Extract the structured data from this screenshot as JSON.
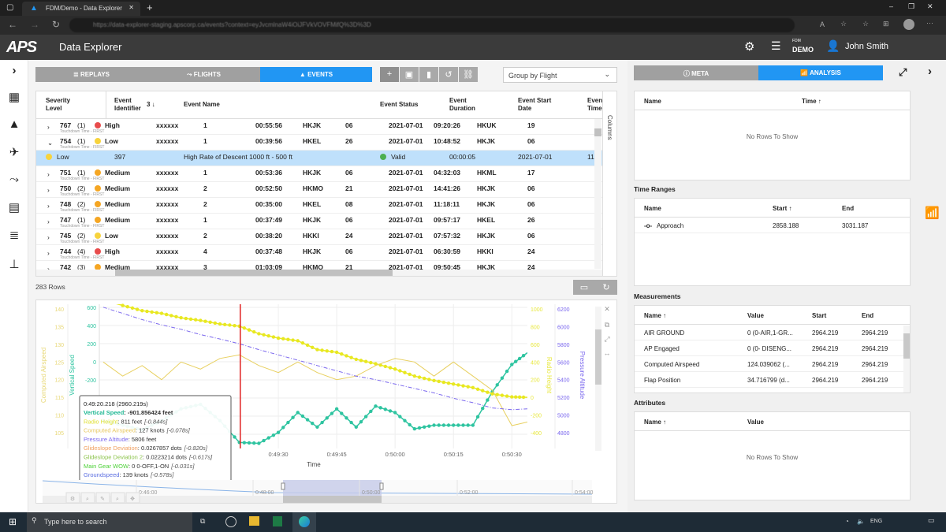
{
  "browser": {
    "tab_title": "FDM/Demo - Data Explorer",
    "url": "https://data-explorer-staging.apscorp.ca/events?context=eyJvcmlnaW4iOiJFVkVOVFMifQ%3D%3D"
  },
  "app": {
    "logo": "APS",
    "title": "Data Explorer",
    "org_small": "FDM",
    "org": "DEMO",
    "user": "John Smith"
  },
  "main_tabs": [
    {
      "label": "REPLAYS",
      "icon": "database-icon"
    },
    {
      "label": "FLIGHTS",
      "icon": "route-icon"
    },
    {
      "label": "EVENTS",
      "icon": "warning-icon",
      "active": true
    }
  ],
  "group_select": {
    "value": "Group by Flight"
  },
  "table": {
    "columns": [
      "Severity Level",
      "Event Identifier",
      "3 ↓",
      "Event Name",
      "Event Status",
      "Event Duration",
      "Event Start Date",
      "Event Time"
    ],
    "sub_label": "Touchdown Time - FIRST",
    "rows": [
      [
        "767",
        "(1)",
        "High",
        "xxxxxx",
        "1",
        "00:55:56",
        "HKJK",
        "06",
        "2021-07-01",
        "09:20:26",
        "HKUK",
        "19"
      ],
      [
        "754",
        "(1)",
        "Low",
        "xxxxxx",
        "1",
        "00:39:56",
        "HKEL",
        "26",
        "2021-07-01",
        "10:48:52",
        "HKJK",
        "06"
      ],
      [
        "751",
        "(1)",
        "Medium",
        "xxxxxx",
        "1",
        "00:53:36",
        "HKJK",
        "06",
        "2021-07-01",
        "04:32:03",
        "HKML",
        "17"
      ],
      [
        "750",
        "(2)",
        "Medium",
        "xxxxxx",
        "2",
        "00:52:50",
        "HKMO",
        "21",
        "2021-07-01",
        "14:41:26",
        "HKJK",
        "06"
      ],
      [
        "748",
        "(2)",
        "Medium",
        "xxxxxx",
        "2",
        "00:35:00",
        "HKEL",
        "08",
        "2021-07-01",
        "11:18:11",
        "HKJK",
        "06"
      ],
      [
        "747",
        "(1)",
        "Medium",
        "xxxxxx",
        "1",
        "00:37:49",
        "HKJK",
        "06",
        "2021-07-01",
        "09:57:17",
        "HKEL",
        "26"
      ],
      [
        "745",
        "(2)",
        "Low",
        "xxxxxx",
        "2",
        "00:38:20",
        "HKKI",
        "24",
        "2021-07-01",
        "07:57:32",
        "HKJK",
        "06"
      ],
      [
        "744",
        "(4)",
        "High",
        "xxxxxx",
        "4",
        "00:37:48",
        "HKJK",
        "06",
        "2021-07-01",
        "06:30:59",
        "HKKI",
        "24"
      ],
      [
        "742",
        "(3)",
        "Medium",
        "xxxxxx",
        "3",
        "01:03:09",
        "HKMO",
        "21",
        "2021-07-01",
        "09:50:45",
        "HKJK",
        "24"
      ]
    ],
    "expanded": {
      "severity": "Low",
      "identifier": "397",
      "name": "High Rate of Descent 1000 ft - 500 ft",
      "status": "Valid",
      "duration": "00:00:05",
      "start_date": "2021-07-01",
      "time": "11"
    },
    "columns_label": "Columns",
    "row_count": "283 Rows"
  },
  "severity_colors": {
    "High": "#e84c4c",
    "Medium": "#f5a623",
    "Low": "#f7d33c",
    "Valid": "#4caf50"
  },
  "chart_data": {
    "type": "line",
    "xlabel": "Time",
    "x_ticks": [
      "0:49:30",
      "0:49:45",
      "0:50:00",
      "0:50:15",
      "0:50:30"
    ],
    "x_range": [
      "0:48:44",
      "0:50:34"
    ],
    "x": [
      "0:48:45",
      "0:48:50",
      "0:48:55",
      "0:49:00",
      "0:49:05",
      "0:49:10",
      "0:49:15",
      "0:49:20",
      "0:49:25",
      "0:49:30",
      "0:49:35",
      "0:49:40",
      "0:49:45",
      "0:49:50",
      "0:49:55",
      "0:50:00",
      "0:50:05",
      "0:50:10",
      "0:50:15",
      "0:50:20",
      "0:50:25",
      "0:50:30",
      "0:50:34"
    ],
    "axes": [
      {
        "id": "cas",
        "label": "Computed Airspeed",
        "side": "left",
        "range": [
          105,
          140
        ],
        "ticks": [
          105,
          110,
          115,
          120,
          125,
          130,
          135,
          140
        ],
        "color": "#e8d878"
      },
      {
        "id": "vs",
        "label": "Vertical Speed",
        "side": "left",
        "range": [
          -1000,
          600
        ],
        "ticks": [
          -200,
          0,
          200,
          400,
          600
        ],
        "color": "#2ec4a0"
      },
      {
        "id": "rh",
        "label": "Radio Height",
        "side": "right",
        "range": [
          -400,
          1000
        ],
        "ticks": [
          -400,
          -200,
          0,
          200,
          400,
          600,
          800,
          1000
        ],
        "color": "#e8e840"
      },
      {
        "id": "pa",
        "label": "Pressure Altitude",
        "side": "right",
        "range": [
          4800,
          6200
        ],
        "ticks": [
          4800,
          5000,
          5200,
          5400,
          5600,
          5800,
          6000,
          6200
        ],
        "color": "#7b68ee"
      }
    ],
    "series": [
      {
        "name": "Vertical Speed",
        "axis": "vs",
        "color": "#2ec4a0",
        "style": "dots",
        "values": [
          -650,
          -700,
          -750,
          -650,
          -520,
          -470,
          -650,
          -890,
          -900,
          -780,
          -560,
          -720,
          -520,
          -720,
          -490,
          -560,
          -740,
          -700,
          -700,
          -700,
          -330,
          -30,
          100
        ]
      },
      {
        "name": "Radio Height",
        "axis": "rh",
        "color": "#e8e820",
        "style": "dots",
        "values": [
          1100,
          1040,
          980,
          950,
          900,
          870,
          830,
          805,
          720,
          670,
          640,
          540,
          510,
          430,
          380,
          320,
          240,
          190,
          150,
          110,
          40,
          5,
          0
        ]
      },
      {
        "name": "Computed Airspeed",
        "axis": "cas",
        "color": "#e8d060",
        "style": "line",
        "values": [
          125,
          121,
          124,
          120,
          125,
          123,
          126,
          127,
          124,
          122,
          125,
          122,
          120,
          121,
          124,
          126,
          125,
          121,
          125,
          121,
          117,
          107,
          108
        ]
      },
      {
        "name": "Pressure Altitude",
        "axis": "pa",
        "color": "#7b68ee",
        "style": "dashdot",
        "values": [
          6220,
          6150,
          6080,
          6020,
          5970,
          5910,
          5860,
          5806,
          5740,
          5680,
          5620,
          5560,
          5500,
          5440,
          5400,
          5350,
          5300,
          5250,
          5190,
          5140,
          5080,
          5060,
          5070
        ]
      }
    ],
    "cursor_time": "0:49:20.218",
    "tooltip": {
      "title": "0:49:20.218 (2960.219s)",
      "items": [
        {
          "name": "Vertical Speed",
          "value": "-901.856424 feet",
          "offset": "",
          "color": "#1fb894"
        },
        {
          "name": "Radio Height",
          "value": "811 feet",
          "offset": "[-0.844s]",
          "color": "#e0e030"
        },
        {
          "name": "Computed Airspeed",
          "value": "127 knots",
          "offset": "[-0.078s]",
          "color": "#e8c860"
        },
        {
          "name": "Pressure Altitude",
          "value": "5806 feet",
          "offset": "",
          "color": "#7b68ee"
        },
        {
          "name": "Glideslope Deviation",
          "value": "0.0267857 dots",
          "offset": "[-0.820s]",
          "color": "#f0a060"
        },
        {
          "name": "Glideslope Deviation 2",
          "value": "0.0223214 dots",
          "offset": "[-0.617s]",
          "color": "#8bc34a"
        },
        {
          "name": "Main Gear WOW",
          "value": "0 0-OFF,1-ON",
          "offset": "[-0.031s]",
          "color": "#4cd137"
        },
        {
          "name": "Groundspeed",
          "value": "139 knots",
          "offset": "[-0.578s]",
          "color": "#5b6ee1"
        }
      ]
    },
    "navigator_ticks": [
      "0:46:00",
      "0:48:00",
      "0:50:00",
      "0:52:00",
      "0:54:00"
    ]
  },
  "right_tabs": [
    {
      "label": "META",
      "icon": "info-icon"
    },
    {
      "label": "ANALYSIS",
      "icon": "analysis-icon",
      "active": true
    }
  ],
  "markers": {
    "columns": [
      "Name",
      "Time ↑"
    ],
    "empty": "No Rows To Show"
  },
  "time_ranges": {
    "title": "Time Ranges",
    "columns": [
      "Name",
      "Start ↑",
      "End"
    ],
    "rows": [
      [
        "Approach",
        "2858.188",
        "3031.187"
      ]
    ]
  },
  "measurements": {
    "title": "Measurements",
    "columns": [
      "Name ↑",
      "Value",
      "Start",
      "End"
    ],
    "rows": [
      [
        "AIR GROUND",
        "0 (0-AIR,1-GR...",
        "2964.219",
        "2964.219"
      ],
      [
        "AP Engaged",
        "0 (0- DISENG...",
        "2964.219",
        "2964.219"
      ],
      [
        "Computed Airspeed",
        "124.039062 (...",
        "2964.219",
        "2964.219"
      ],
      [
        "Flap Position",
        "34.716799 (d...",
        "2964.219",
        "2964.219"
      ]
    ]
  },
  "attributes": {
    "title": "Attributes",
    "columns": [
      "Name ↑",
      "Value"
    ],
    "empty": "No Rows To Show"
  },
  "taskbar": {
    "search_placeholder": "Type here to search",
    "lang": "ENG"
  }
}
